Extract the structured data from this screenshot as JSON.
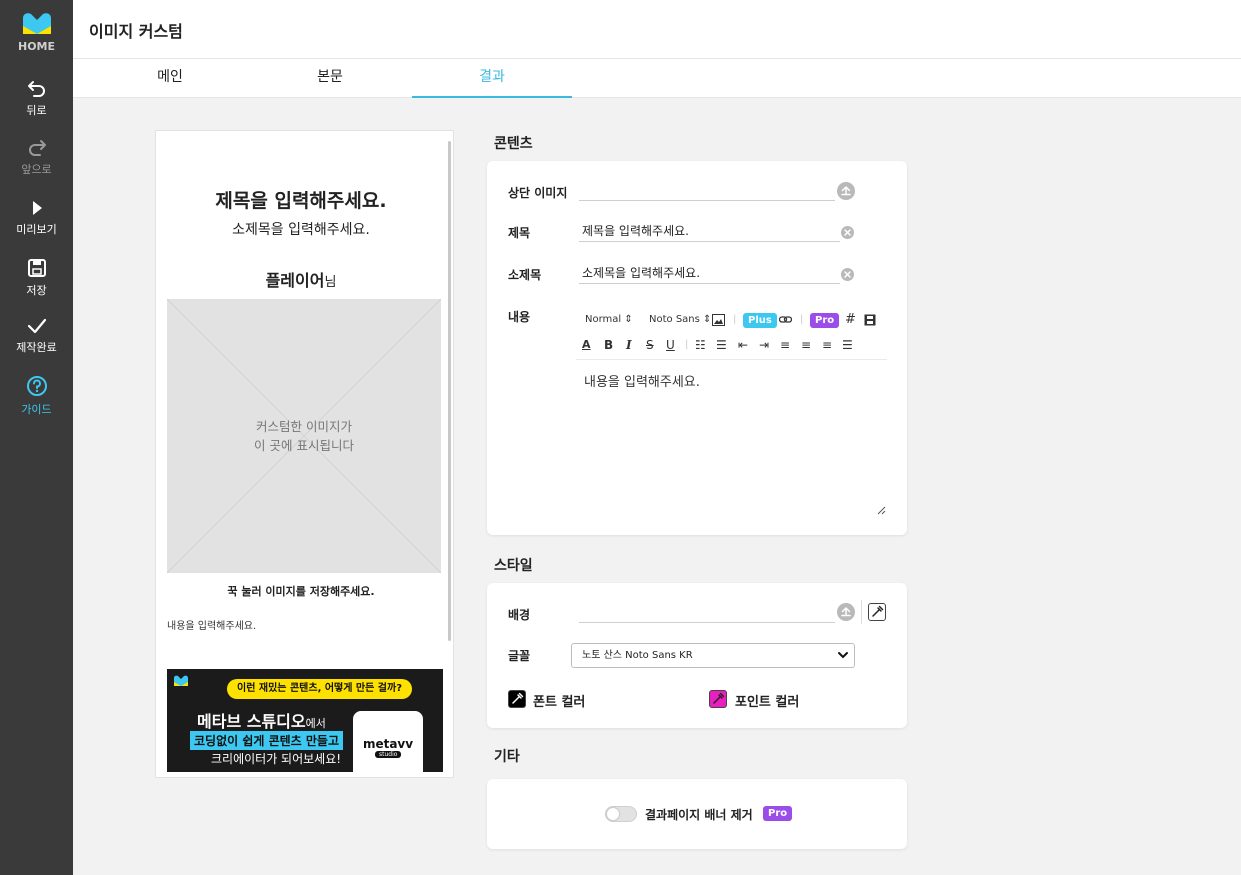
{
  "sidebar": {
    "home_label": "HOME",
    "items": [
      {
        "label": "뒤로"
      },
      {
        "label": "앞으로"
      },
      {
        "label": "미리보기"
      },
      {
        "label": "저장"
      },
      {
        "label": "제작완료"
      },
      {
        "label": "가이드"
      }
    ]
  },
  "header": {
    "title": "이미지 커스텀"
  },
  "tabs": [
    {
      "label": "메인"
    },
    {
      "label": "본문"
    },
    {
      "label": "결과",
      "active": true
    }
  ],
  "preview": {
    "title": "제목을 입력해주세요.",
    "subtitle": "소제목을 입력해주세요.",
    "player": "플레이어",
    "player_suffix": "님",
    "image_line1": "커스텀한 이미지가",
    "image_line2": "이 곳에 표시됩니다",
    "save_hint": "꾹 눌러 이미지를 저장해주세요.",
    "body": "내용을 입력해주세요.",
    "banner": {
      "question": "이런 재밌는 콘텐츠, 어떻게 만든 걸까?",
      "line1_bold": "메타브 스튜디오",
      "line1_small": "에서",
      "line2": "코딩없이 쉽게 콘텐츠 만들고",
      "line3": "크리에이터가 되어보세요!",
      "phone_title": "metavv",
      "phone_sub": "studio"
    }
  },
  "content_section": {
    "title": "콘텐츠",
    "top_image_label": "상단 이미지",
    "title_label": "제목",
    "title_value": "제목을 입력해주세요.",
    "subtitle_label": "소제목",
    "subtitle_value": "소제목을 입력해주세요.",
    "body_label": "내용",
    "toolbar": {
      "size": "Normal",
      "font": "Noto Sans",
      "plus_badge": "Plus",
      "pro_badge": "Pro"
    },
    "body_value": "내용을 입력해주세요."
  },
  "style_section": {
    "title": "스타일",
    "bg_label": "배경",
    "font_label": "글꼴",
    "font_value": "노토 산스 Noto Sans KR",
    "font_color_label": "폰트 컬러",
    "font_color": "#000000",
    "point_color_label": "포인트 컬러",
    "point_color": "#e91fbf"
  },
  "etc_section": {
    "title": "기타",
    "toggle_label": "결과페이지 배너 제거",
    "toggle_badge": "Pro",
    "toggle_on": false
  },
  "colors": {
    "accent": "#3cb9e0",
    "plus": "#3cc8f0",
    "pro": "#9b4dea",
    "sidebar": "#3a3a3a"
  }
}
